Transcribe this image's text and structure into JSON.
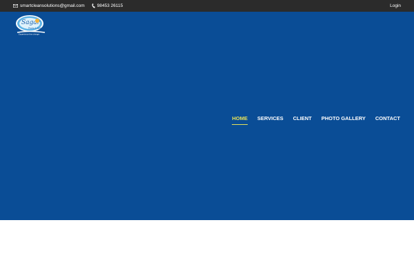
{
  "topbar": {
    "email": "smartcleansolutions@gmail.com",
    "phone": "98453 26115",
    "login_label": "Login",
    "email_icon": "envelope-icon",
    "phone_icon": "phone-icon",
    "background": "#2b2b2b"
  },
  "logo": {
    "brand_text": "Sagar",
    "sub_text": "Pools & Spa",
    "tagline_text": "Experience the change"
  },
  "nav": {
    "items": [
      {
        "label": "HOME",
        "active": true
      },
      {
        "label": "SERVICES",
        "active": false
      },
      {
        "label": "CLIENT",
        "active": false
      },
      {
        "label": "PHOTO GALLERY",
        "active": false
      },
      {
        "label": "CONTACT",
        "active": false
      }
    ],
    "active_color": "#e8e35a"
  },
  "hero": {
    "background": "#0a4d96"
  }
}
